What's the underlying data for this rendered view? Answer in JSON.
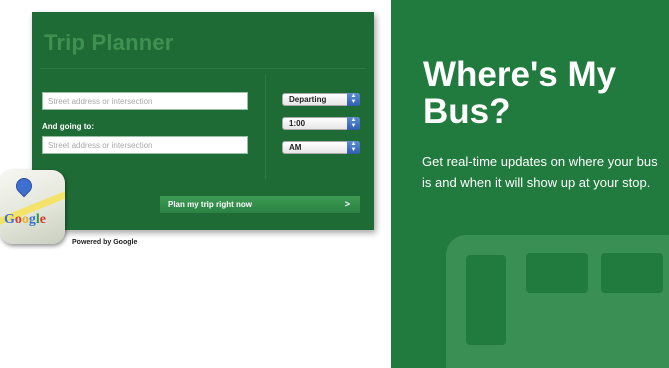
{
  "planner": {
    "title": "Trip Planner",
    "origin_placeholder": "Street address or intersection",
    "going_to_label": "And going to:",
    "destination_placeholder": "Street address or intersection",
    "depart_select": "Departing",
    "time_select": "1:00",
    "ampm_select": "AM",
    "plan_button": "Plan my trip right now",
    "plan_button_chevron": ">"
  },
  "google": {
    "icon_word": "Google",
    "powered_by": "Powered by Google"
  },
  "bus_panel": {
    "title": "Where's My Bus?",
    "description": "Get real-time updates on where your bus is and when it will show up at your stop."
  },
  "colors": {
    "planner_bg": "#1f6b36",
    "bus_panel_bg": "#217a3e",
    "button_bg": "#3d9a52"
  }
}
